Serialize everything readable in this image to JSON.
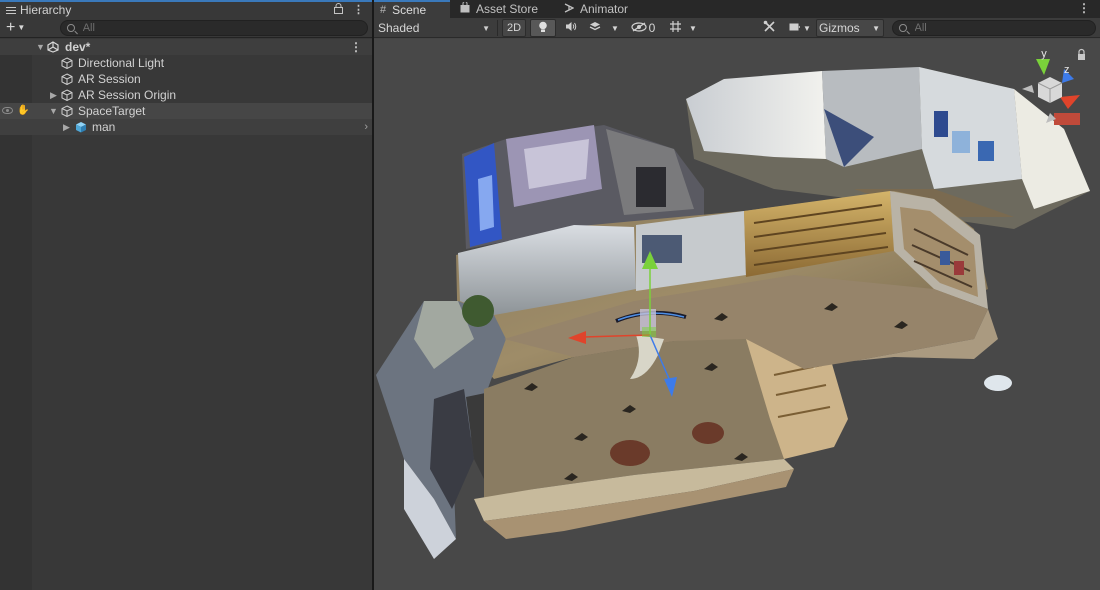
{
  "hierarchy": {
    "tab_label": "Hierarchy",
    "search_placeholder": "All",
    "scene_name": "dev*",
    "items": [
      {
        "label": "Directional Light"
      },
      {
        "label": "AR Session"
      },
      {
        "label": "AR Session Origin"
      },
      {
        "label": "SpaceTarget"
      },
      {
        "label": "man"
      }
    ]
  },
  "scene_view": {
    "tabs": [
      {
        "label": "Scene",
        "icon": "grid-icon"
      },
      {
        "label": "Asset Store",
        "icon": "bag-icon"
      },
      {
        "label": "Animator",
        "icon": "animator-icon"
      }
    ],
    "toolbar": {
      "draw_mode": "Shaded",
      "mode_2d": "2D",
      "hidden_count": "0",
      "gizmos_label": "Gizmos",
      "search_placeholder": "All"
    },
    "orientation_gizmo": {
      "y_label": "y",
      "z_label": "z"
    }
  },
  "colors": {
    "accent_tab": "#3a79bb",
    "axis_x": "#e0442b",
    "axis_y": "#7ad13a",
    "axis_z": "#3d7bea",
    "panel_bg": "#383838",
    "viewport_bg": "#484848"
  }
}
